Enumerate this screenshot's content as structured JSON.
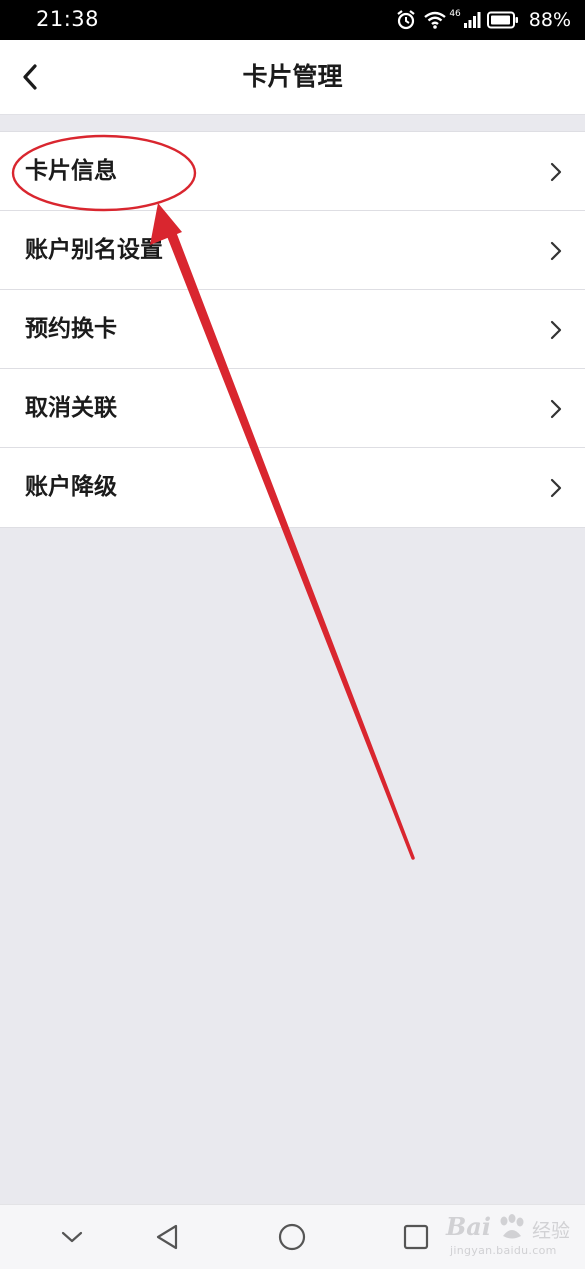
{
  "status_bar": {
    "time": "21:38",
    "battery": "88%",
    "network": "46",
    "icons": [
      "alarm-icon",
      "wifi-icon",
      "signal-icon",
      "battery-icon"
    ]
  },
  "header": {
    "title": "卡片管理",
    "back_icon": "chevron-left-icon"
  },
  "menu": {
    "items": [
      {
        "label": "卡片信息"
      },
      {
        "label": "账户别名设置"
      },
      {
        "label": "预约换卡"
      },
      {
        "label": "取消关联"
      },
      {
        "label": "账户降级"
      }
    ]
  },
  "bottom_nav": {
    "buttons": [
      "chevron-down-icon",
      "back-triangle-icon",
      "home-circle-icon",
      "recents-square-icon"
    ]
  },
  "annotation": {
    "color": "#d9262f"
  },
  "watermark": {
    "brand": "Bai",
    "brand_tail": "经验",
    "site": "jingyan.baidu.com"
  },
  "colors": {
    "background": "#e9e9ee",
    "surface": "#ffffff",
    "text": "#1b1b1b",
    "divider": "#dedee3",
    "status_bar": "#000000"
  }
}
